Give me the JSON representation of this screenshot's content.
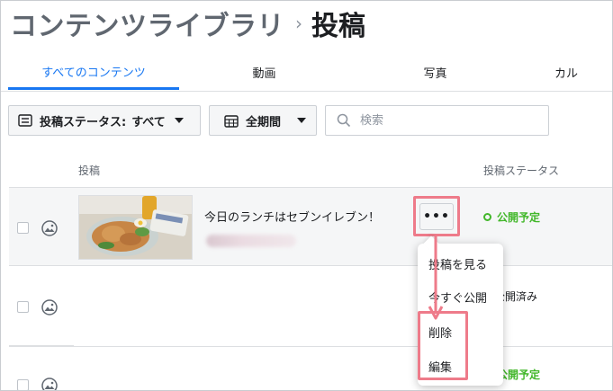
{
  "header": {
    "title": "コンテンツライブラリ",
    "separator": "›",
    "current": "投稿"
  },
  "tabs": [
    {
      "label": "すべてのコンテンツ",
      "active": true
    },
    {
      "label": "動画"
    },
    {
      "label": "写真"
    },
    {
      "label": "カル"
    }
  ],
  "filters": {
    "status_label": "投稿ステータス:",
    "status_value": "すべて",
    "period_label": "全期間"
  },
  "search": {
    "placeholder": "検索"
  },
  "table": {
    "col_post": "投稿",
    "col_status": "投稿ステータス",
    "rows": [
      {
        "text": "今日のランチはセブンイレブン！",
        "status": "公開予定",
        "status_type": "scheduled"
      },
      {
        "text": "",
        "status": "公開済み",
        "status_type": "published"
      },
      {
        "text": "",
        "status": "公開予定",
        "status_type": "scheduled"
      }
    ]
  },
  "more_button": {
    "label": "•••"
  },
  "menu": {
    "items": [
      "投稿を見る",
      "今すぐ公開",
      "削除",
      "編集"
    ]
  },
  "colors": {
    "accent": "#1877f2",
    "scheduled": "#42b72a",
    "highlight": "#ee7b8a"
  },
  "icons": {
    "filter": "list-icon",
    "calendar": "calendar-icon",
    "search": "search-icon",
    "row_type": "image-icon",
    "more": "more-horizontal-icon"
  }
}
